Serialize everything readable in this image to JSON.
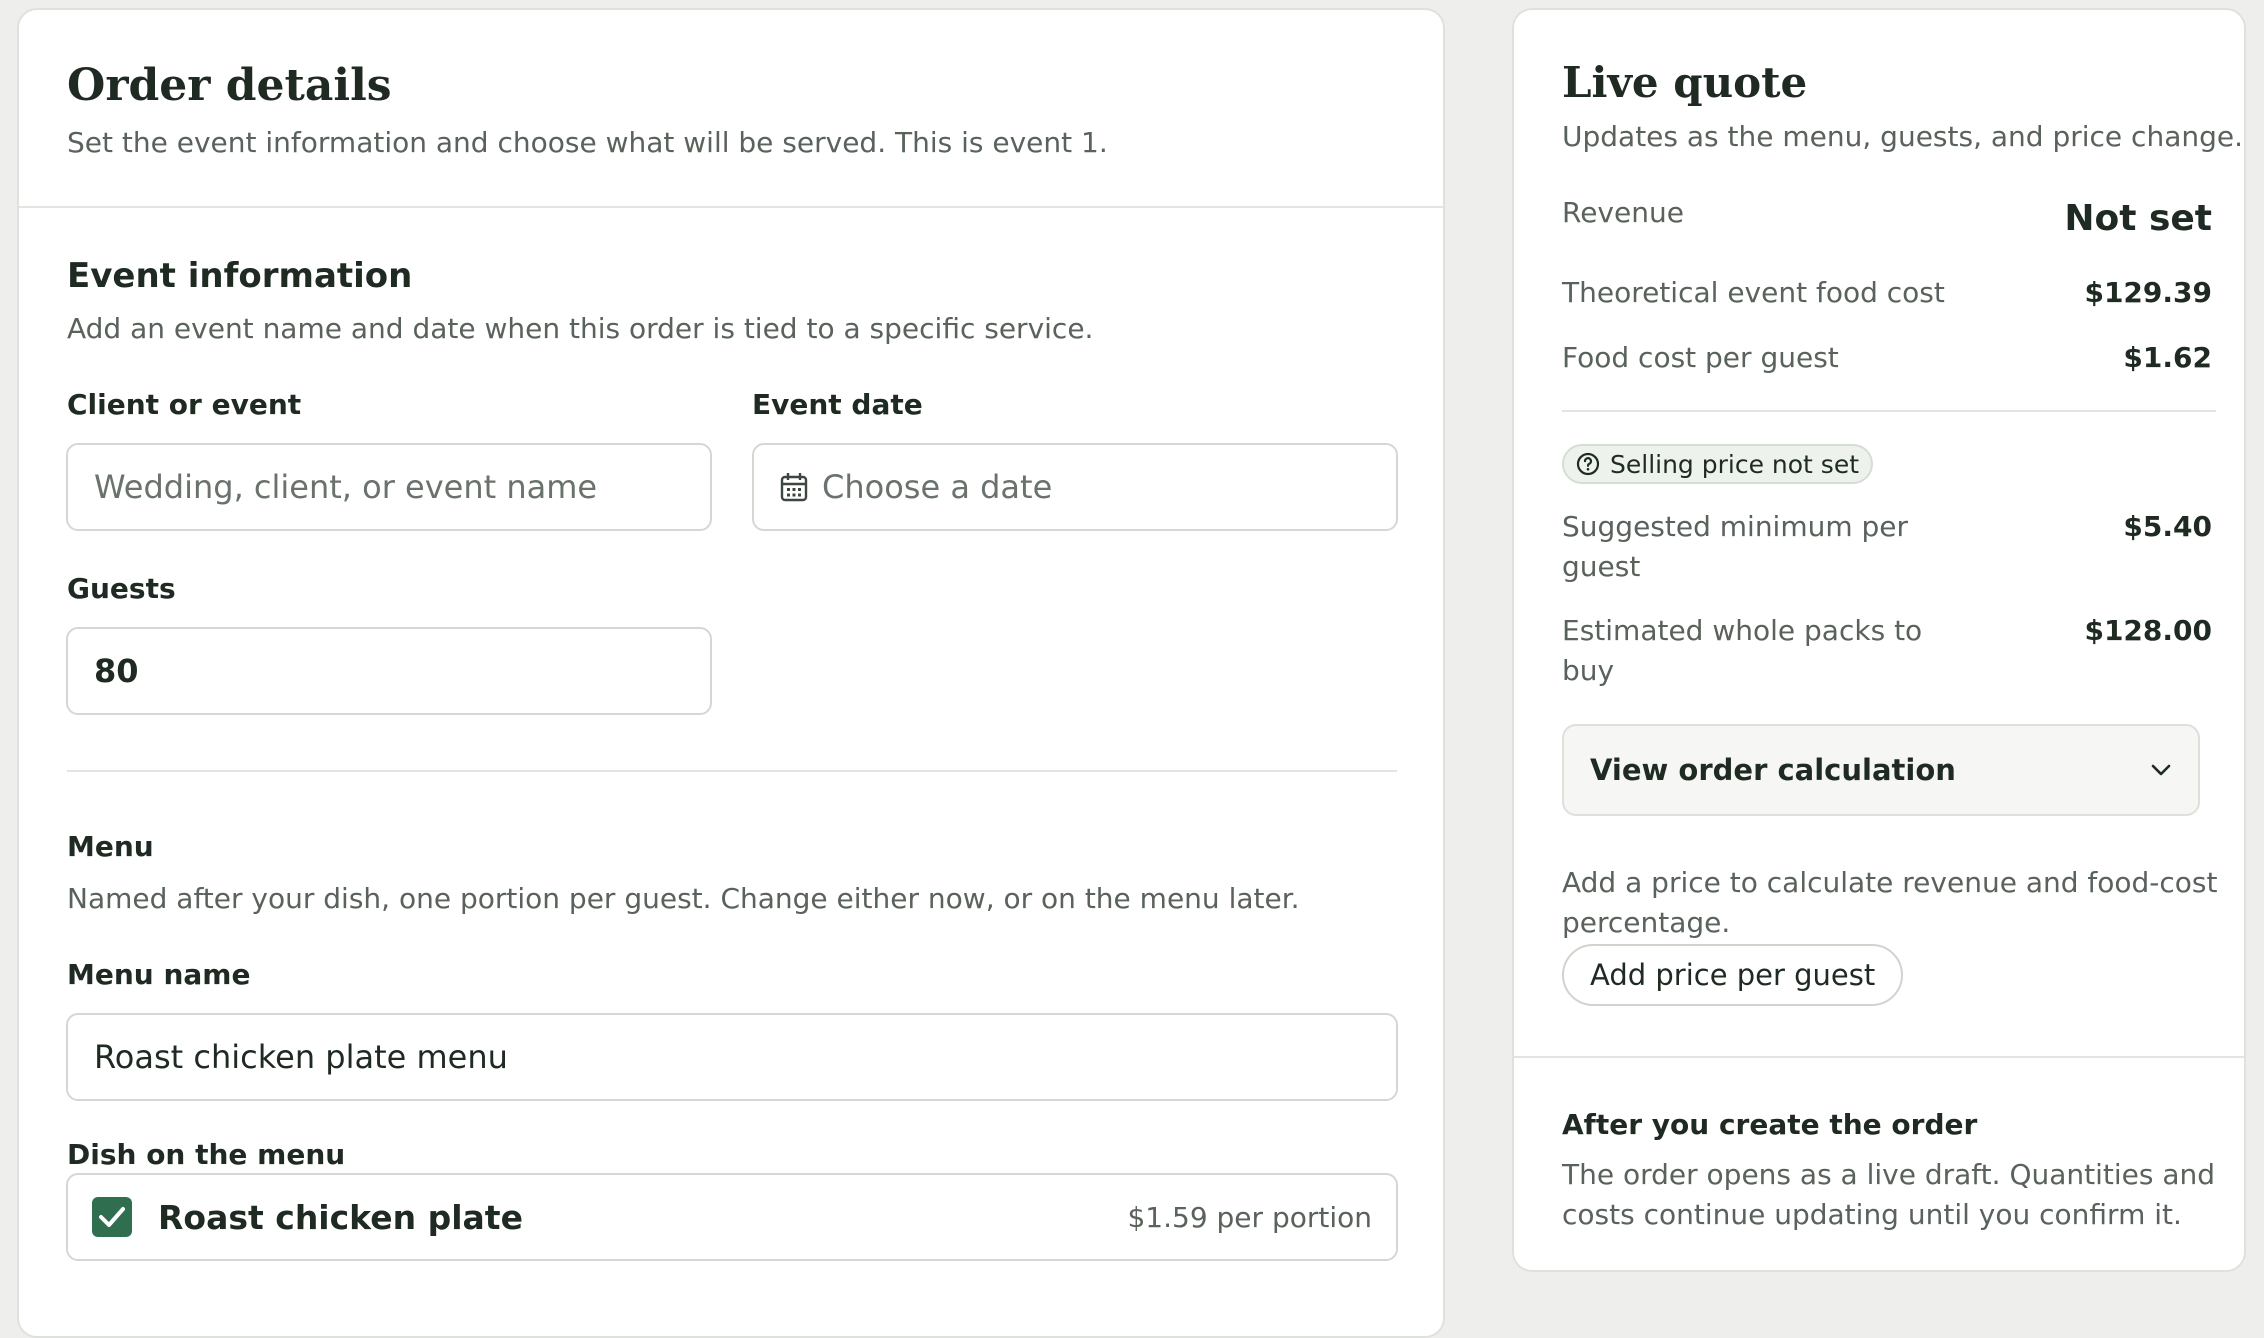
{
  "order_details": {
    "title": "Order details",
    "subtitle": "Set the event information and choose what will be served. This is event 1.",
    "event_info": {
      "title": "Event information",
      "description": "Add an event name and date when this order is tied to a specific service.",
      "client_label": "Client or event",
      "client_placeholder": "Wedding, client, or event name",
      "date_label": "Event date",
      "date_placeholder": "Choose a date",
      "guests_label": "Guests",
      "guests_value": "80"
    },
    "menu": {
      "title": "Menu",
      "description": "Named after your dish, one portion per guest. Change either now, or on the menu later.",
      "name_label": "Menu name",
      "name_value": "Roast chicken plate menu",
      "dish_label": "Dish on the menu",
      "dish_name": "Roast chicken plate",
      "dish_checked": true,
      "dish_price": "$1.59 per portion"
    }
  },
  "live_quote": {
    "title": "Live quote",
    "subtitle": "Updates as the menu, guests, and price change.",
    "revenue_label": "Revenue",
    "revenue_value": "Not set",
    "food_cost_label": "Theoretical event food cost",
    "food_cost_value": "$129.39",
    "per_guest_label": "Food cost per guest",
    "per_guest_value": "$1.62",
    "badge": "Selling price not set",
    "suggested_label_line1": "Suggested minimum per",
    "suggested_label_line2": "guest",
    "suggested_value": "$5.40",
    "packs_label_line1": "Estimated whole packs to",
    "packs_label_line2": "buy",
    "packs_value": "$128.00",
    "calc_label": "View order calculation",
    "hint_line1": "Add a price to calculate revenue and food-cost",
    "hint_line2": "percentage.",
    "add_price_button": "Add price per guest",
    "after_title": "After you create the order",
    "after_line1": "The order opens as a live draft. Quantities and",
    "after_line2": "costs continue updating until you confirm it."
  },
  "colors": {
    "accent": "#2f6f4f",
    "background": "#eeefec",
    "text": "#1e2a22",
    "muted_text": "#59625b"
  }
}
